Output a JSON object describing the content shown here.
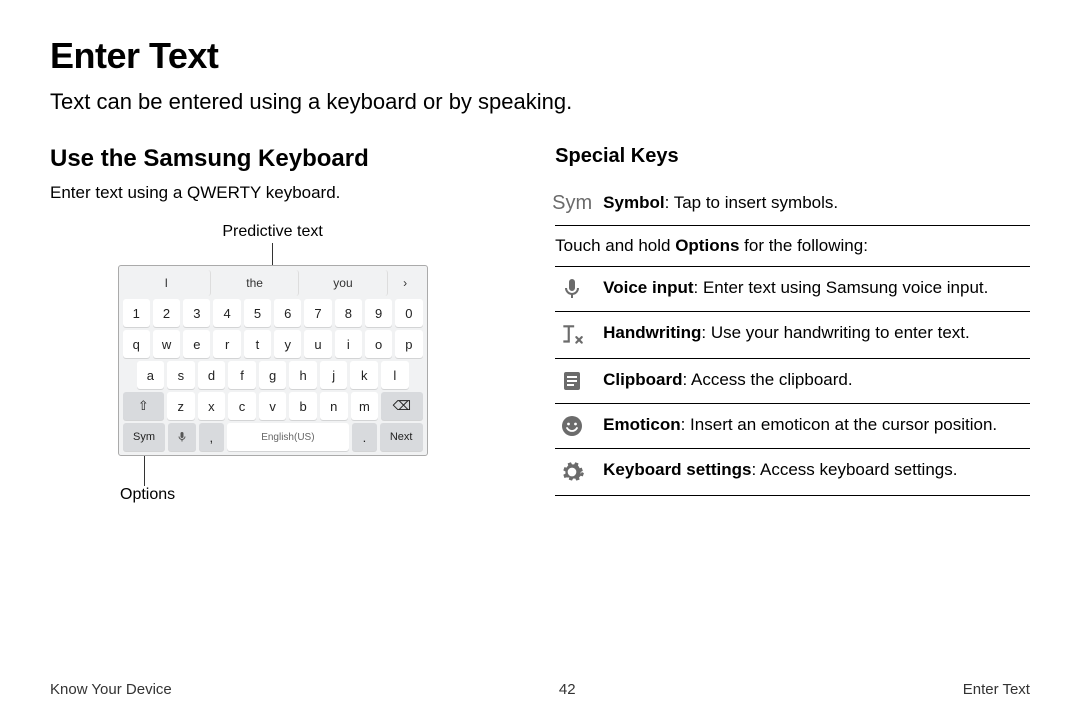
{
  "page": {
    "title": "Enter Text",
    "subtitle": "Text can be entered using a keyboard or by speaking."
  },
  "left": {
    "heading": "Use the Samsung Keyboard",
    "body": "Enter text using a QWERTY keyboard.",
    "label_predictive": "Predictive text",
    "label_options": "Options",
    "suggestions": [
      "I",
      "the",
      "you",
      "›"
    ],
    "row_num": [
      "1",
      "2",
      "3",
      "4",
      "5",
      "6",
      "7",
      "8",
      "9",
      "0"
    ],
    "row_q": [
      "q",
      "w",
      "e",
      "r",
      "t",
      "y",
      "u",
      "i",
      "o",
      "p"
    ],
    "row_a": [
      "a",
      "s",
      "d",
      "f",
      "g",
      "h",
      "j",
      "k",
      "l"
    ],
    "row_z": [
      "z",
      "x",
      "c",
      "v",
      "b",
      "n",
      "m"
    ],
    "key_sym": "Sym",
    "key_comma": ",",
    "key_space": "English(US)",
    "key_period": ".",
    "key_next": "Next",
    "key_shift": "⇧",
    "key_backspace": "⌫"
  },
  "right": {
    "heading": "Special Keys",
    "sym_label": "Sym",
    "sym_bold": "Symbol",
    "sym_rest": ": Tap to insert symbols.",
    "intro_pre": "Touch and hold ",
    "intro_bold": "Options",
    "intro_post": " for the following:",
    "items": [
      {
        "bold": "Voice input",
        "rest": ": Enter text using Samsung voice input."
      },
      {
        "bold": "Handwriting",
        "rest": ": Use your handwriting to enter text."
      },
      {
        "bold": "Clipboard",
        "rest": ": Access the clipboard."
      },
      {
        "bold": "Emoticon",
        "rest": ": Insert an emoticon at the cursor position."
      },
      {
        "bold": "Keyboard settings",
        "rest": ": Access keyboard settings."
      }
    ]
  },
  "footer": {
    "left": "Know Your Device",
    "center": "42",
    "right": "Enter Text"
  }
}
